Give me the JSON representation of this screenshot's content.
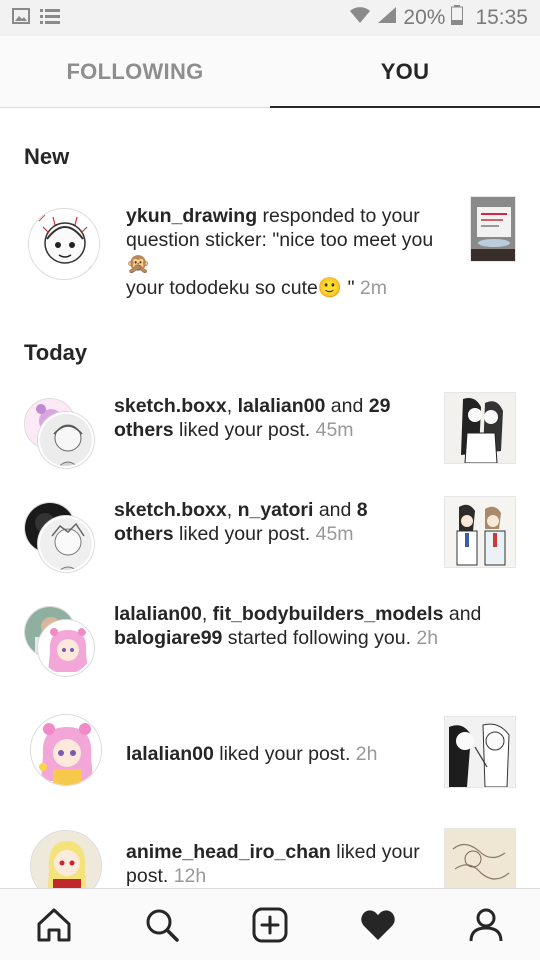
{
  "status_bar": {
    "battery": "20%",
    "time": "15:35",
    "icons": [
      "image-icon",
      "list-icon",
      "wifi-icon",
      "signal-icon",
      "battery-icon"
    ]
  },
  "tabs": [
    {
      "label": "FOLLOWING",
      "active": false
    },
    {
      "label": "YOU",
      "active": true
    }
  ],
  "sections": {
    "new": "New",
    "today": "Today"
  },
  "notifications": [
    {
      "user": "ykun_drawing",
      "text": " responded to your question sticker: \"nice too meet you🙊",
      "line2": "your tododeku so cute🙂 \"",
      "time": " 2m"
    },
    {
      "users": [
        "sketch.boxx",
        "lalalian00"
      ],
      "sep": ", ",
      "mid": " and ",
      "others": "29 others",
      "text": " liked your post.",
      "time": " 45m"
    },
    {
      "users": [
        "sketch.boxx",
        "n_yatori"
      ],
      "sep": ", ",
      "mid": " and ",
      "others": "8 others",
      "text": " liked your post.",
      "time": " 45m"
    },
    {
      "users": [
        "lalalian00",
        "fit_bodybuilders_models"
      ],
      "sep": ", ",
      "mid": " and ",
      "others": "balogiare99",
      "text": " started following you.",
      "time": " 2h"
    },
    {
      "user": "lalalian00",
      "text": " liked your post.",
      "time": " 2h"
    },
    {
      "user": "anime_head_iro_chan",
      "text": " liked your post.",
      "time": " 12h"
    }
  ],
  "bottom_nav": [
    "home-icon",
    "search-icon",
    "add-post-icon",
    "activity-heart-icon",
    "profile-icon"
  ],
  "colors": {
    "text": "#262626",
    "muted": "#999999",
    "divider": "#dbdbdb"
  }
}
